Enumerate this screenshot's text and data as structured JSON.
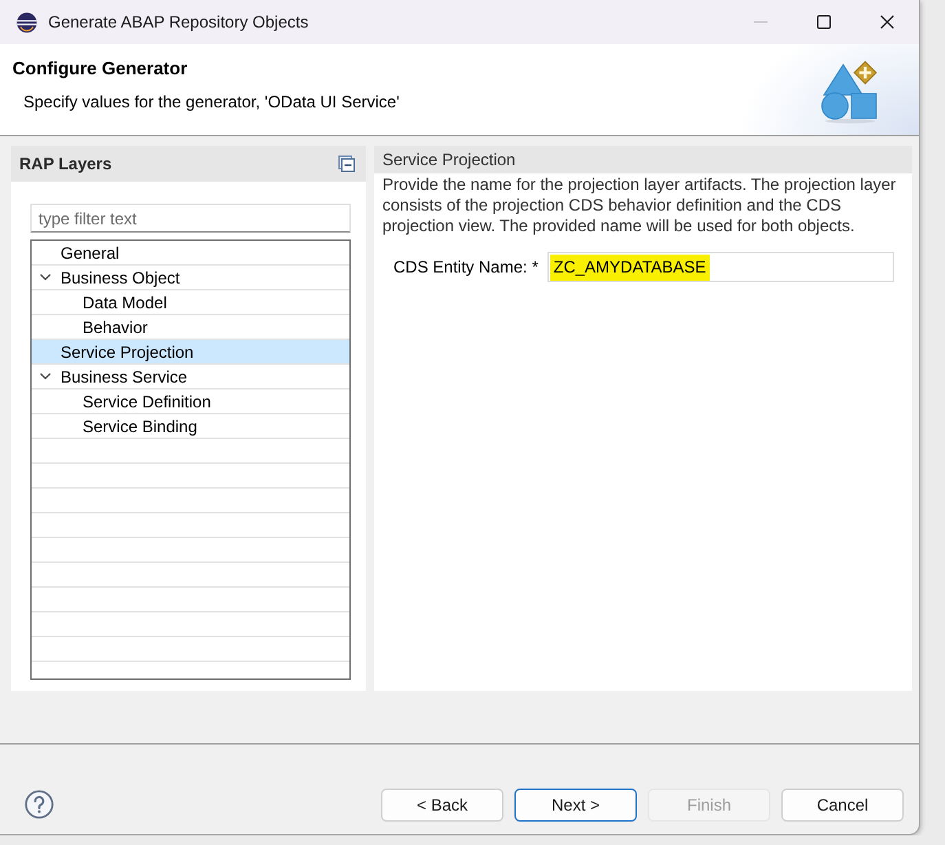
{
  "window": {
    "title": "Generate ABAP Repository Objects",
    "buttons": [
      {
        "kind": "minimize",
        "disabled": true
      },
      {
        "kind": "maximize",
        "disabled": false
      },
      {
        "kind": "close",
        "disabled": false
      }
    ]
  },
  "header": {
    "title": "Configure Generator",
    "description": "Specify values for the generator, 'OData UI Service'"
  },
  "layers_panel": {
    "title": "RAP Layers",
    "filter": {
      "placeholder": "type filter text"
    },
    "tree": [
      {
        "label": "General",
        "selected": false
      },
      {
        "label": "Business Object",
        "selected": false,
        "expanded": true,
        "children": [
          {
            "label": "Data Model",
            "selected": false
          },
          {
            "label": "Behavior",
            "selected": false
          }
        ]
      },
      {
        "label": "Service Projection",
        "selected": true
      },
      {
        "label": "Business Service",
        "selected": false,
        "expanded": true,
        "children": [
          {
            "label": "Service Definition",
            "selected": false
          },
          {
            "label": "Service Binding",
            "selected": false
          }
        ]
      }
    ]
  },
  "details": {
    "title": "Service Projection",
    "description": "Provide the name for the projection layer artifacts. The projection layer consists of the projection CDS behavior definition and the CDS projection view. The provided name will be used for both objects.",
    "fields": [
      {
        "label": "CDS Entity Name: *",
        "value": "ZC_AMYDATABASE",
        "highlighted": true
      }
    ]
  },
  "buttons": [
    {
      "label": "< Back",
      "default": false,
      "disabled": false
    },
    {
      "label": "Next >",
      "default": true,
      "disabled": false
    },
    {
      "label": "Finish",
      "default": false,
      "disabled": true
    },
    {
      "label": "Cancel",
      "default": false,
      "disabled": false
    }
  ]
}
